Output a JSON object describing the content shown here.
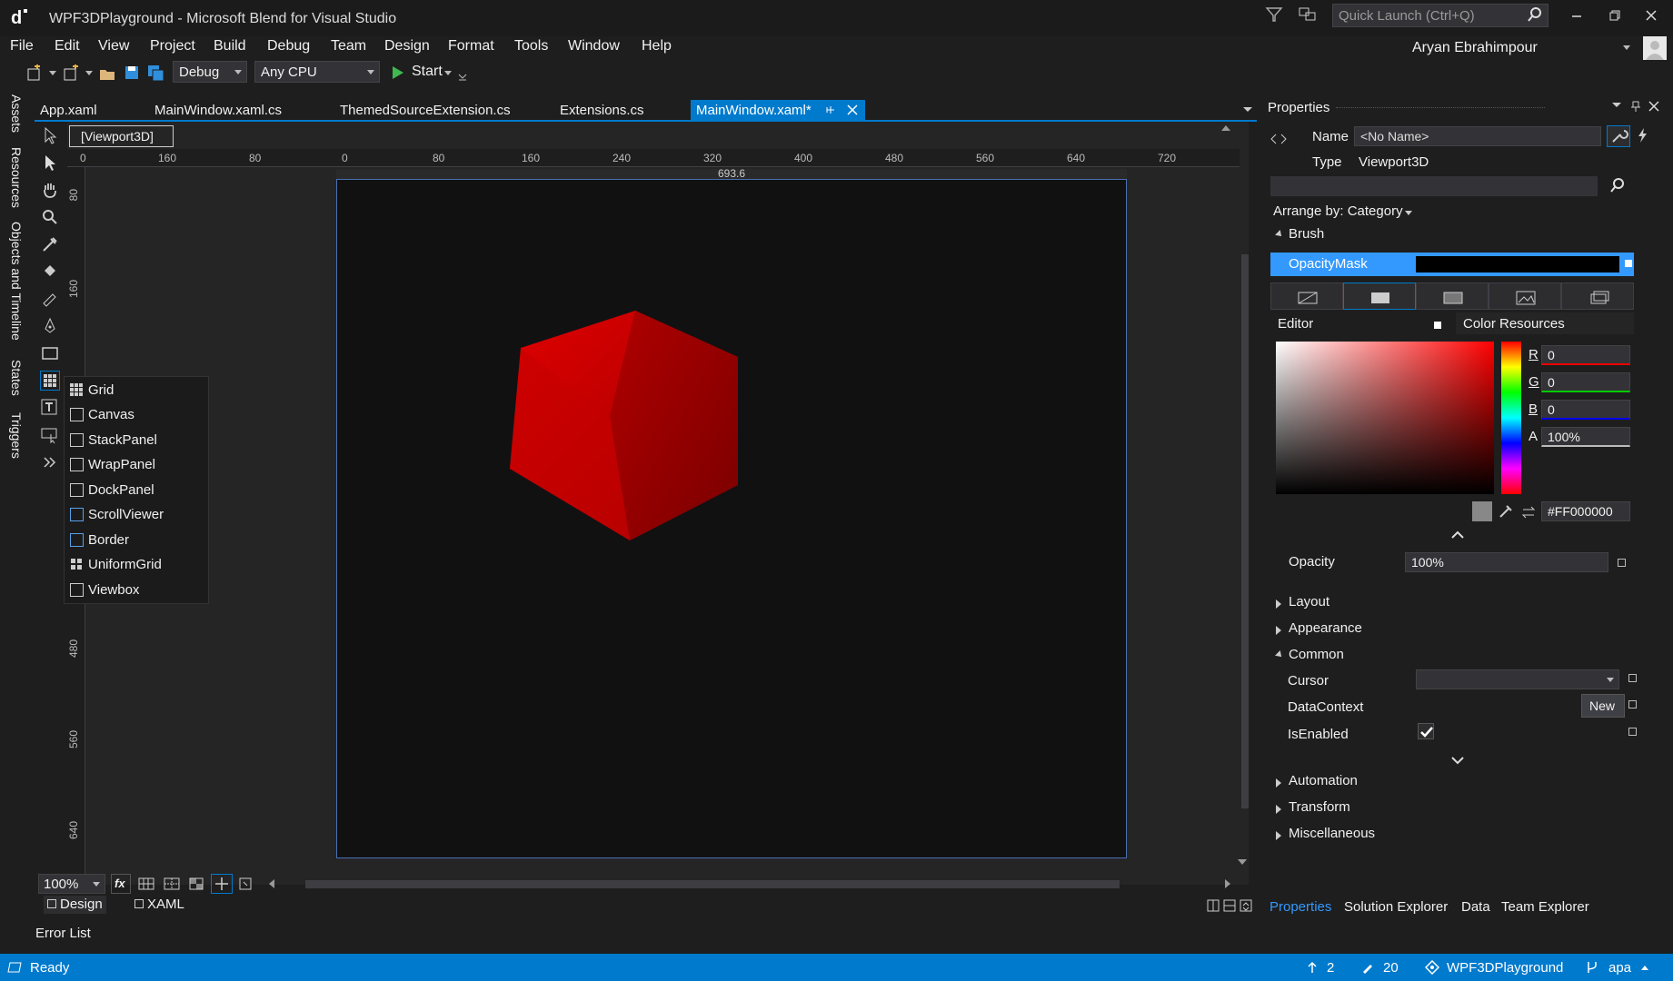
{
  "titlebar": {
    "app_title": "WPF3DPlayground - Microsoft Blend for Visual Studio",
    "quick_launch_placeholder": "Quick Launch (Ctrl+Q)",
    "user_name": "Aryan Ebrahimpour"
  },
  "menu": [
    "File",
    "Edit",
    "View",
    "Project",
    "Build",
    "Debug",
    "Team",
    "Design",
    "Format",
    "Tools",
    "Window",
    "Help"
  ],
  "toolbar": {
    "configuration": "Debug",
    "platform": "Any CPU",
    "start_label": "Start"
  },
  "left_tabs": [
    "Assets",
    "Resources",
    "Objects and Timeline",
    "States",
    "Triggers"
  ],
  "doc_tabs": [
    {
      "label": "App.xaml"
    },
    {
      "label": "MainWindow.xaml.cs"
    },
    {
      "label": "ThemedSourceExtension.cs"
    },
    {
      "label": "Extensions.cs"
    },
    {
      "label": "MainWindow.xaml*"
    }
  ],
  "designer": {
    "breadcrumb": "[Viewport3D]",
    "width_readout": "693.6",
    "ruler_h": [
      "0",
      "160",
      "80",
      "0",
      "80",
      "160",
      "240",
      "320",
      "400",
      "480",
      "560",
      "640",
      "720"
    ],
    "ruler_v": [
      "80",
      "160",
      "480",
      "560",
      "640"
    ],
    "zoom": "100%",
    "view_design": "Design",
    "view_xaml": "XAML"
  },
  "flyout": [
    "Grid",
    "Canvas",
    "StackPanel",
    "WrapPanel",
    "DockPanel",
    "ScrollViewer",
    "Border",
    "UniformGrid",
    "Viewbox"
  ],
  "properties": {
    "panel_title": "Properties",
    "name_label": "Name",
    "name_value": "<No Name>",
    "type_label": "Type",
    "type_value": "Viewport3D",
    "arrange_by": "Arrange by: Category",
    "section_brush": "Brush",
    "opacity_mask": "OpacityMask",
    "editor_label": "Editor",
    "color_resources": "Color Resources",
    "channels": [
      {
        "label": "R",
        "value": "0"
      },
      {
        "label": "G",
        "value": "0"
      },
      {
        "label": "B",
        "value": "0"
      },
      {
        "label": "A",
        "value": "100%"
      }
    ],
    "hex_value": "#FF000000",
    "opacity_label": "Opacity",
    "opacity_value": "100%",
    "section_layout": "Layout",
    "section_appearance": "Appearance",
    "section_common": "Common",
    "cursor_label": "Cursor",
    "datacontext_label": "DataContext",
    "new_button": "New",
    "isenabled_label": "IsEnabled",
    "section_automation": "Automation",
    "section_transform": "Transform",
    "section_misc": "Miscellaneous",
    "bottom_tabs": [
      "Properties",
      "Solution Explorer",
      "Data",
      "Team Explorer"
    ]
  },
  "error_list": "Error List",
  "statusbar": {
    "ready": "Ready",
    "up_count": "2",
    "edit_count": "20",
    "project": "WPF3DPlayground",
    "branch": "apa"
  },
  "colors": {
    "accent": "#007acc",
    "cube": "#cc0000"
  }
}
